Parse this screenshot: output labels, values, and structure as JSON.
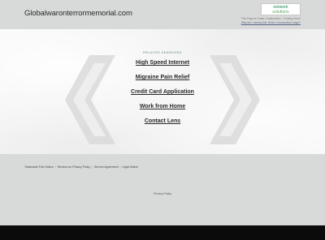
{
  "header": {
    "domain": "Globalwaronterrormemorial.com",
    "logo_line1": "network",
    "logo_line2": "solutions",
    "uc_line1": "This Page is Under Construction - Coming Soon!",
    "uc_link": "Why am I seeing this 'Under Construction' page?"
  },
  "main": {
    "related_label": "RELATED SEARCHES",
    "searches": [
      "High Speed Internet",
      "Migraine Pain Relief",
      "Credit Card Application",
      "Work from Home",
      "Contact Lens"
    ]
  },
  "footer": {
    "links": [
      "Trademark Free Notice",
      "Review our Privacy Policy",
      "Service Agreement",
      "Legal Notice"
    ],
    "privacy": "Privacy Policy"
  }
}
